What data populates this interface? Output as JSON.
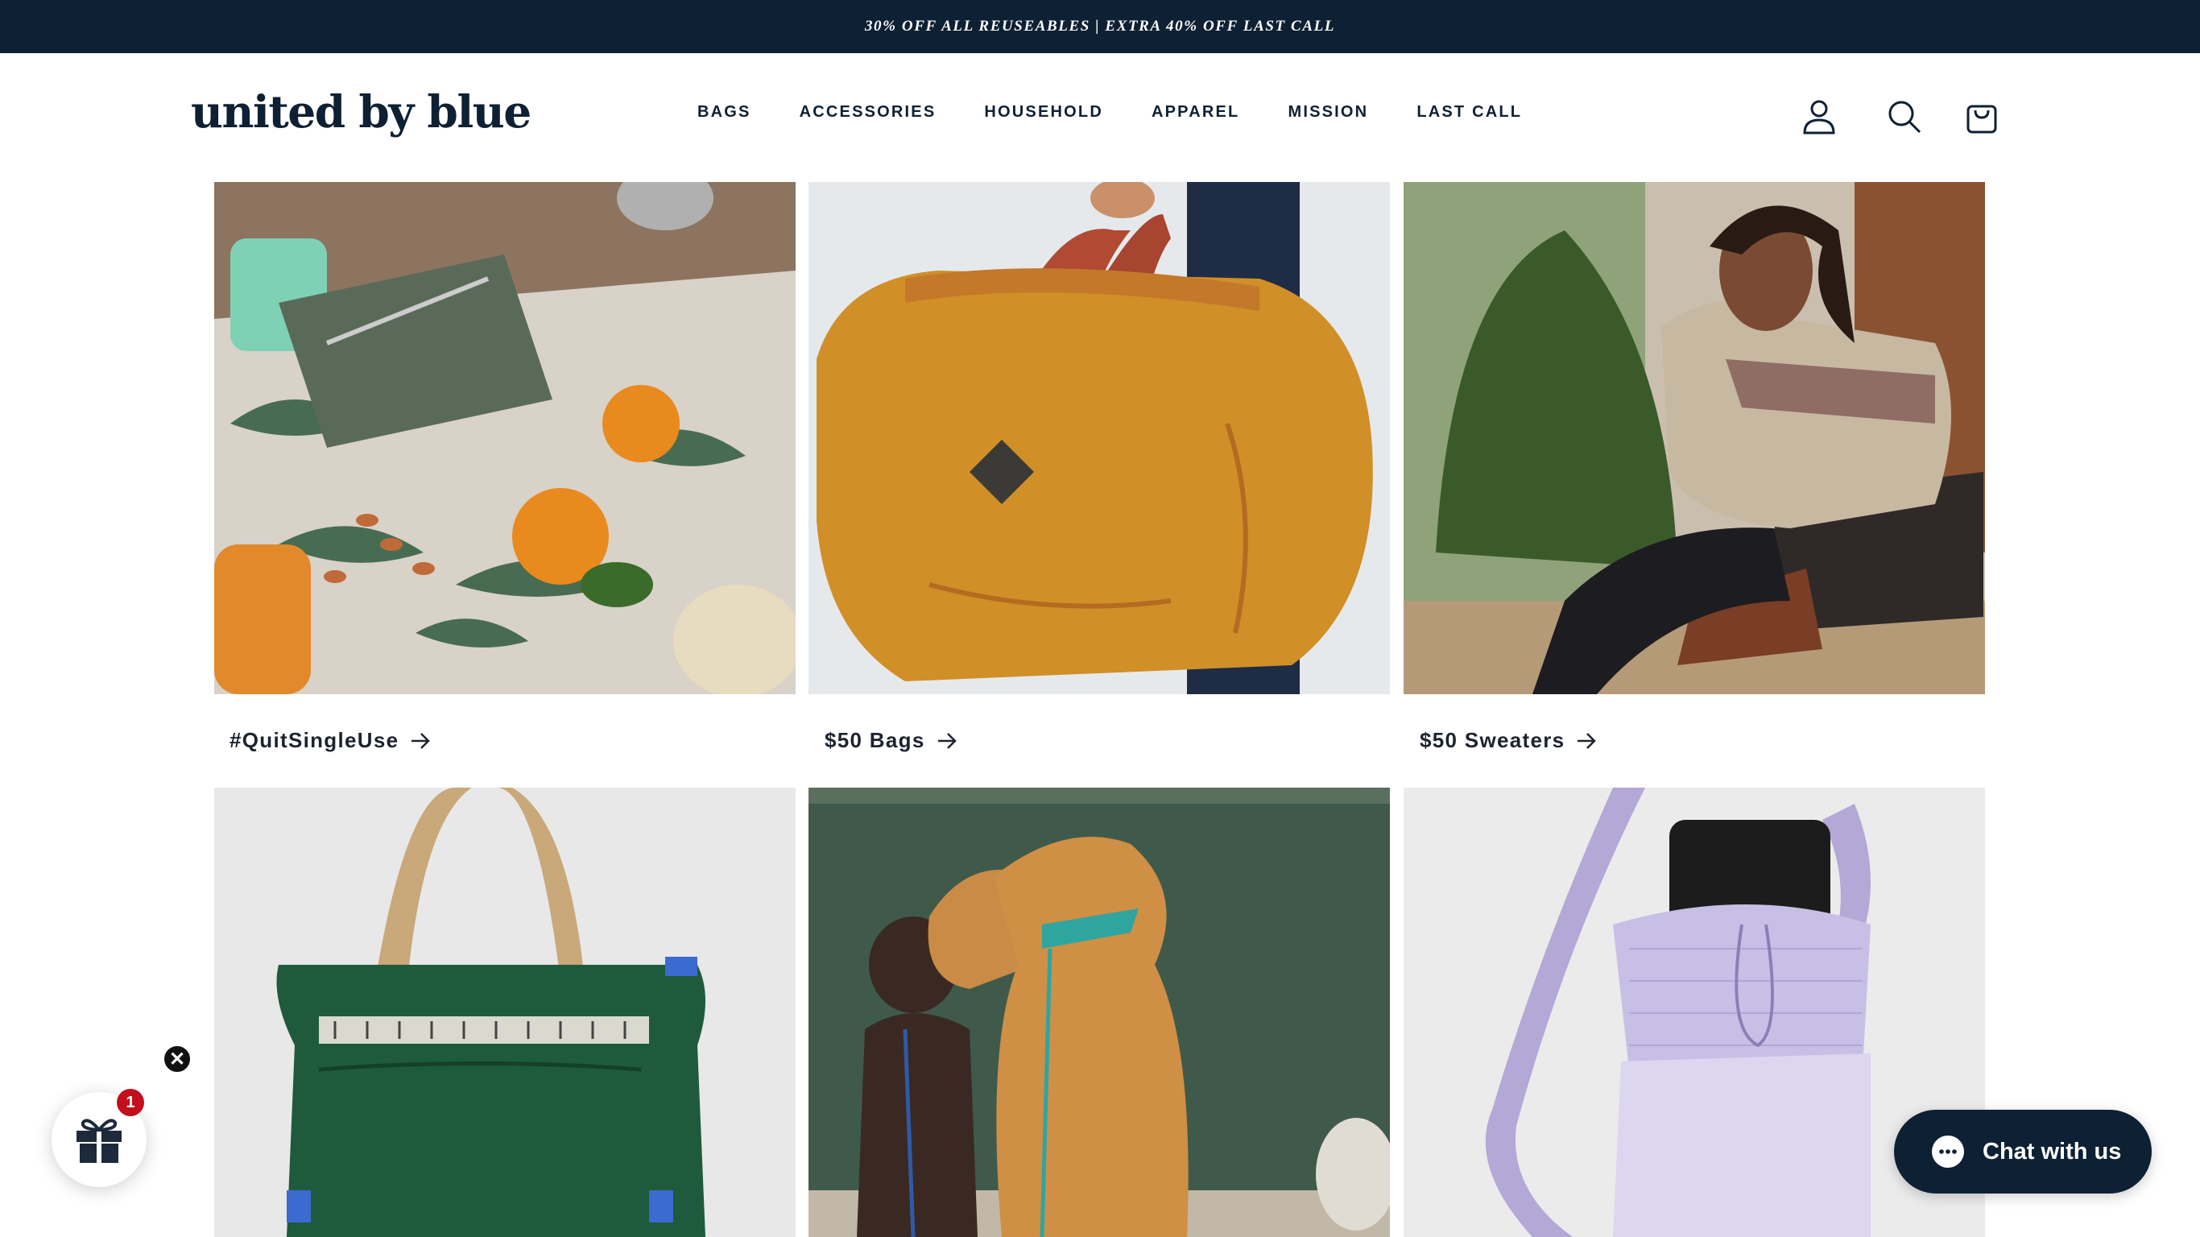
{
  "announcement": "30% OFF ALL REUSEABLES | EXTRA 40% OFF LAST CALL",
  "header": {
    "logo": "united by blue",
    "nav": [
      "BAGS",
      "ACCESSORIES",
      "HOUSEHOLD",
      "APPAREL",
      "MISSION",
      "LAST CALL"
    ],
    "icons": [
      "account-icon",
      "search-icon",
      "cart-icon"
    ]
  },
  "collections": [
    {
      "label": "#QuitSingleUse",
      "image": "picnic-flatlay-with-reusable-utensil-kit"
    },
    {
      "label": "$50 Bags",
      "image": "mustard-duffel-bag"
    },
    {
      "label": "$50 Sweaters",
      "image": "woman-in-fair-isle-sweater"
    }
  ],
  "products_row2": [
    {
      "image": "green-tote-backpack"
    },
    {
      "image": "two-dogs-on-leashes"
    },
    {
      "image": "lavender-bottle-sling"
    }
  ],
  "gift_widget": {
    "badge_count": "1",
    "close": "✕"
  },
  "chat": {
    "label": "Chat with us"
  },
  "colors": {
    "navy": "#0e2033",
    "badge_red": "#c40f1d"
  }
}
